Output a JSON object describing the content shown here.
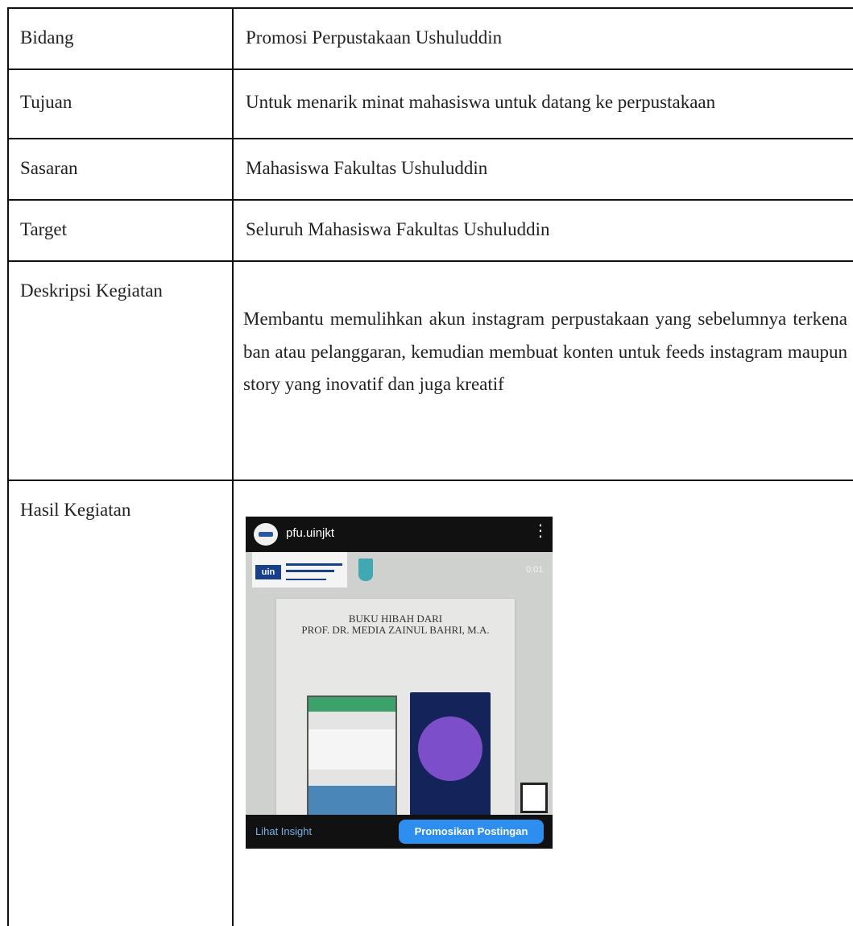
{
  "rows": [
    {
      "label": "Bidang",
      "value": "Promosi Perpustakaan Ushuluddin"
    },
    {
      "label": "Tujuan",
      "value": "Untuk menarik minat mahasiswa untuk datang ke perpustakaan"
    },
    {
      "label": "Sasaran",
      "value": "Mahasiswa Fakultas Ushuluddin"
    },
    {
      "label": "Target",
      "value": "Seluruh Mahasiswa Fakultas Ushuluddin"
    },
    {
      "label": "Deskripsi Kegiatan",
      "value": "Membantu memulihkan akun instagram perpustakaan yang sebelumnya terkena ban atau pelanggaran, kemudian membuat konten untuk feeds instagram maupun story yang inovatif dan juga kreatif"
    },
    {
      "label": "Hasil Kegiatan"
    }
  ],
  "post": {
    "username": "pfu.uinjkt",
    "menu_glyph": "⋮",
    "logo_text": "uin",
    "timestamp": "0:01",
    "card_title": "BUKU HIBAH DARI\nPROF. DR. MEDIA ZAINUL BAHRI, M.A.",
    "insight_label": "Lihat Insight",
    "promote_label": "Promosikan Postingan"
  },
  "colors": {
    "border": "#111111",
    "ig_bar": "#111111",
    "promote_button": "#2e8ef0",
    "insight_link": "#7bb0e8"
  }
}
